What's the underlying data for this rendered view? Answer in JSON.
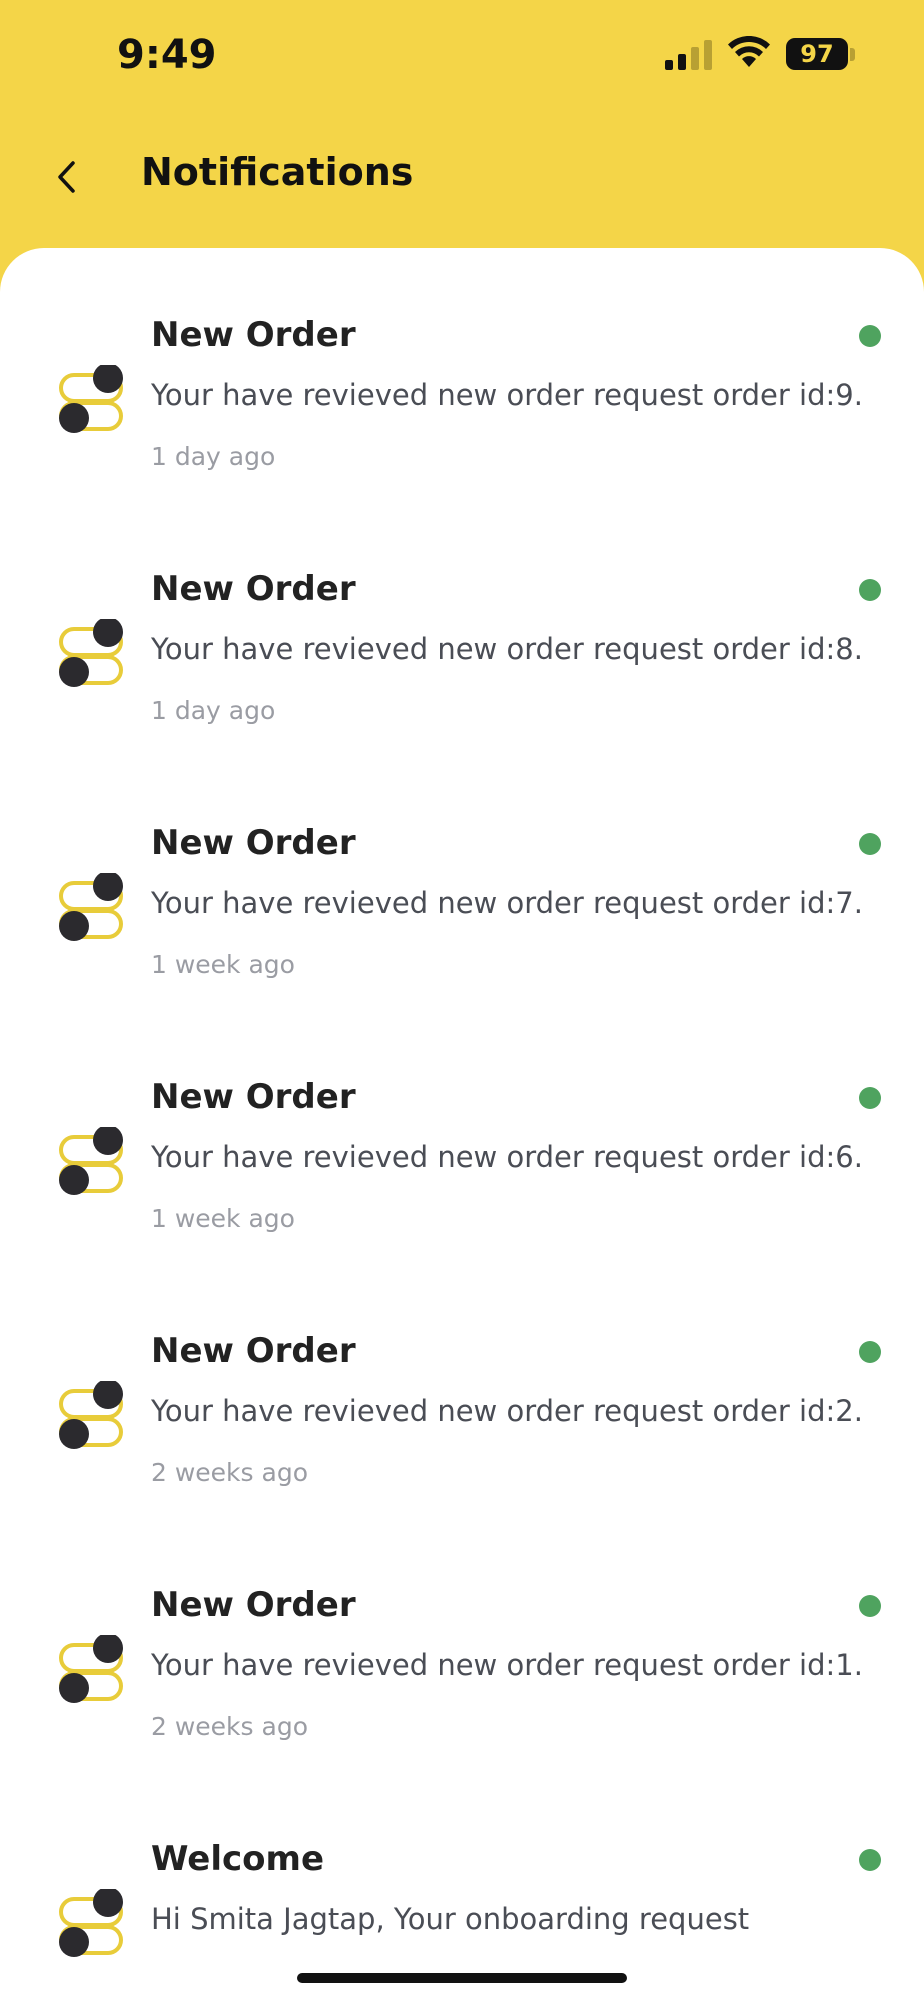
{
  "status_bar": {
    "time": "9:49",
    "battery": "97",
    "signal_icon": "cellular-signal-icon",
    "wifi_icon": "wifi-icon"
  },
  "header": {
    "back_icon": "chevron-left-icon",
    "title": "Notifications"
  },
  "colors": {
    "header_background": "#f4d548",
    "unread_dot": "#4fa35f",
    "icon_accent": "#e8cc3a",
    "icon_dark": "#2b2a2e"
  },
  "notifications": [
    {
      "title": "New Order",
      "message": "Your have revieved new order request order id:9.",
      "time": "1 day ago",
      "unread": true,
      "icon": "toggle-switches-icon"
    },
    {
      "title": "New Order",
      "message": "Your have revieved new order request order id:8.",
      "time": "1 day ago",
      "unread": true,
      "icon": "toggle-switches-icon"
    },
    {
      "title": "New Order",
      "message": "Your have revieved new order request order id:7.",
      "time": "1 week ago",
      "unread": true,
      "icon": "toggle-switches-icon"
    },
    {
      "title": "New Order",
      "message": "Your have revieved new order request order id:6.",
      "time": "1 week ago",
      "unread": true,
      "icon": "toggle-switches-icon"
    },
    {
      "title": "New Order",
      "message": "Your have revieved new order request order id:2.",
      "time": "2 weeks ago",
      "unread": true,
      "icon": "toggle-switches-icon"
    },
    {
      "title": "New Order",
      "message": "Your have revieved new order request order id:1.",
      "time": "2 weeks ago",
      "unread": true,
      "icon": "toggle-switches-icon"
    },
    {
      "title": "Welcome",
      "message": "Hi Smita Jagtap, Your onboarding request",
      "time": "",
      "unread": true,
      "icon": "toggle-switches-icon"
    }
  ]
}
